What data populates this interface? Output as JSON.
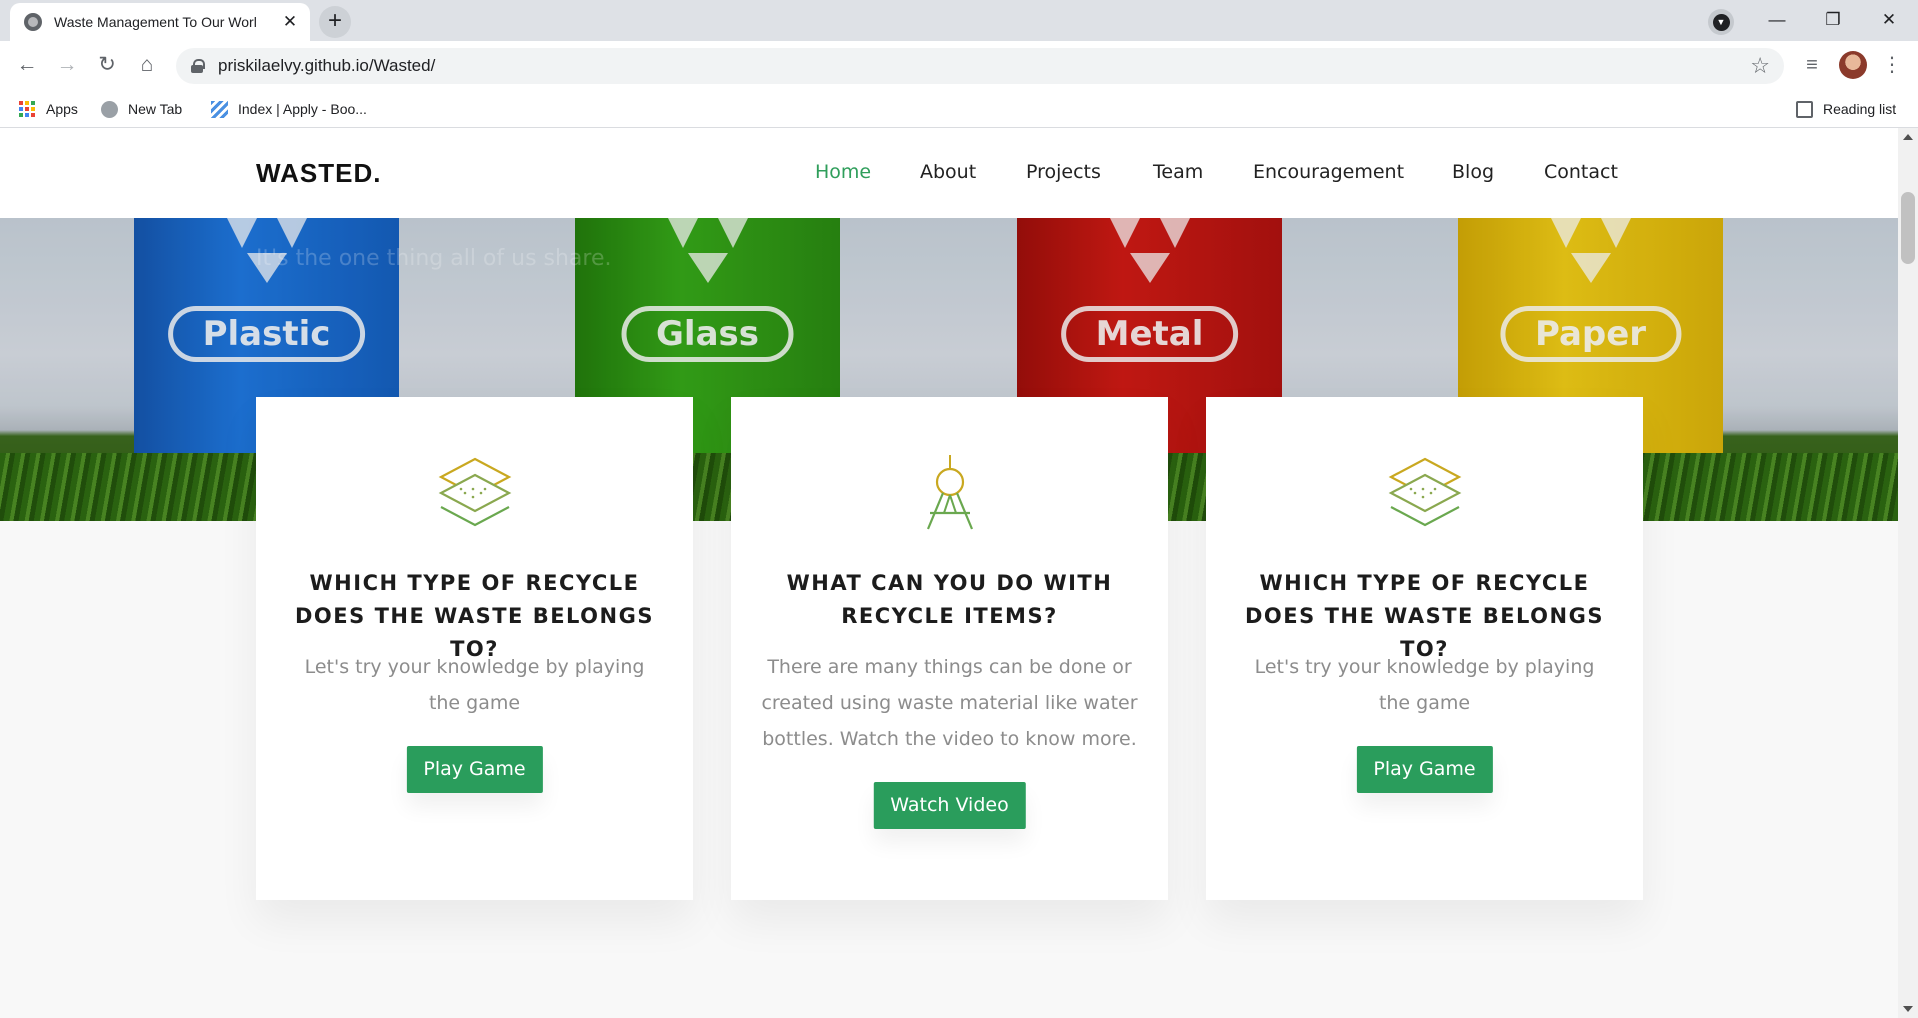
{
  "browser": {
    "tab_title": "Waste Management To Our Worl",
    "tab_close": "✕",
    "new_tab": "+",
    "url": "priskilaelvy.github.io/Wasted/",
    "bookmarks": [
      {
        "label": "Apps"
      },
      {
        "label": "New Tab"
      },
      {
        "label": "Index | Apply - Boo..."
      }
    ],
    "reading_list": "Reading list",
    "window_controls": {
      "minimize": "—",
      "restore": "❐",
      "close": "✕"
    }
  },
  "site": {
    "logo": "WASTED.",
    "nav": [
      "Home",
      "About",
      "Projects",
      "Team",
      "Encouragement",
      "Blog",
      "Contact"
    ],
    "active_nav": "Home",
    "hero_tagline": "It's the one thing all of us share.",
    "bins": [
      "Plastic",
      "Glass",
      "Metal",
      "Paper"
    ],
    "cards": [
      {
        "title": "WHICH TYPE OF RECYCLE DOES THE WASTE BELONGS TO?",
        "text": "Let's try your knowledge by playing the game",
        "button": "Play Game",
        "icon": "layers-icon"
      },
      {
        "title": "WHAT CAN YOU DO WITH RECYCLE ITEMS?",
        "text": "There are many things can be done or created using waste material like water bottles. Watch the video to know more.",
        "button": "Watch Video",
        "icon": "compass-icon"
      },
      {
        "title": "WHICH TYPE OF RECYCLE DOES THE WASTE BELONGS TO?",
        "text": "Let's try your knowledge by playing the game",
        "button": "Play Game",
        "icon": "layers-icon"
      }
    ]
  },
  "colors": {
    "accent": "#2a9d5c",
    "nav_active": "#2f9e5b",
    "icon_gold": "#c9a820",
    "icon_green": "#6aa84f",
    "bin_blue": "#1a6fd1",
    "bin_green": "#2f9e14",
    "bin_red": "#c91510",
    "bin_yellow": "#e8c20c"
  }
}
